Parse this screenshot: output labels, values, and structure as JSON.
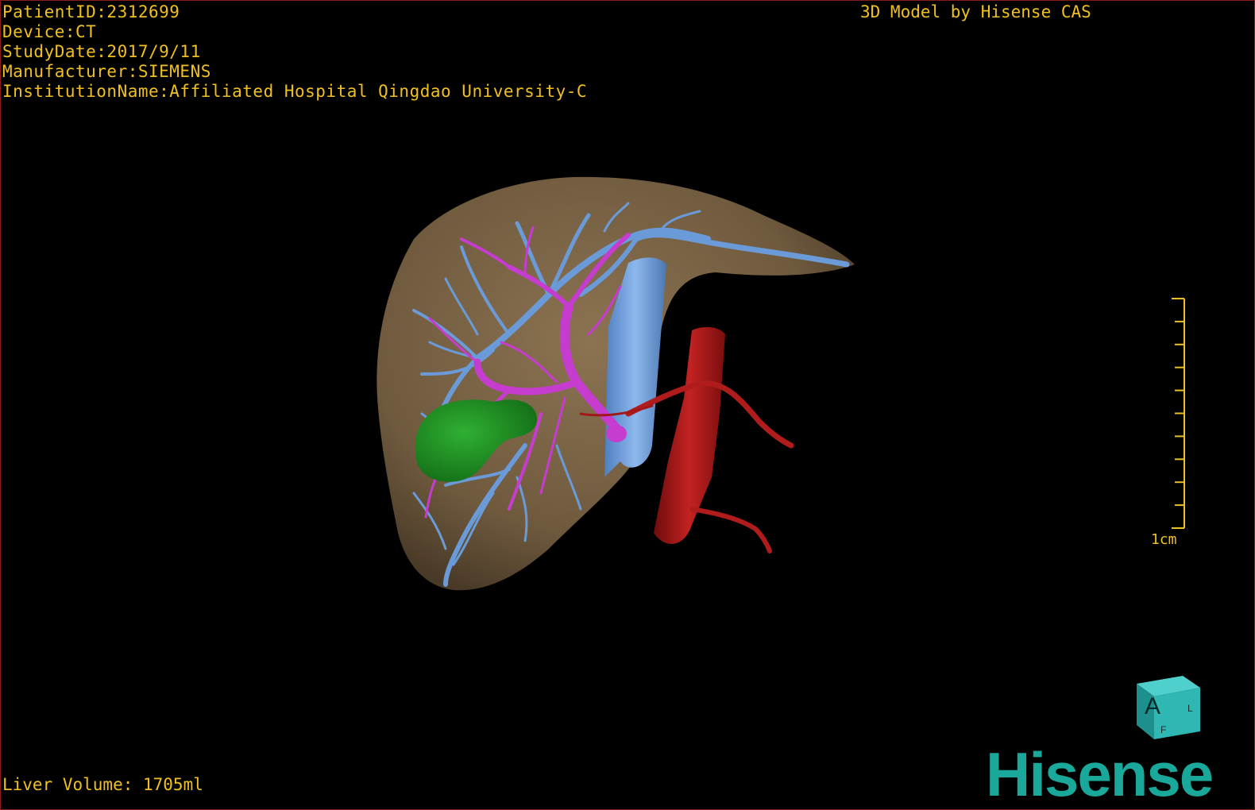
{
  "info": {
    "patient_id": "PatientID:2312699",
    "device": "Device:CT",
    "study_date": "StudyDate:2017/9/11",
    "manufacturer": "Manufacturer:SIEMENS",
    "institution": "InstitutionName:Affiliated Hospital Qingdao University-C"
  },
  "credit": "3D Model by Hisense CAS",
  "liver_volume": "Liver Volume: 1705ml",
  "scale_bar": {
    "label": "1cm",
    "ticks": 11
  },
  "orientation_cube": {
    "front": "A",
    "side": "L",
    "bottom": "F"
  },
  "brand": "Hisense",
  "colors": {
    "text": "#f0c020",
    "liver": "#7a6347",
    "hepatic_veins": "#6a9bd8",
    "portal_vein": "#c63ccf",
    "tumor": "#1f8f24",
    "artery": "#a11818",
    "brand": "#1aa89a",
    "border": "#8a1c1c"
  }
}
